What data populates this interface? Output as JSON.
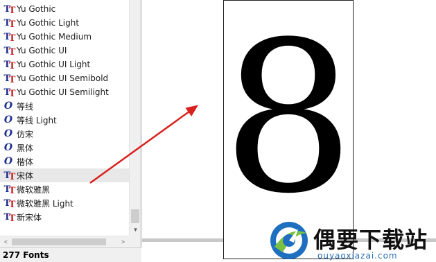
{
  "font_list": {
    "items": [
      {
        "name": "Yu Gothic",
        "icon": "truetype-icon"
      },
      {
        "name": "Yu Gothic Light",
        "icon": "truetype-icon"
      },
      {
        "name": "Yu Gothic Medium",
        "icon": "truetype-icon"
      },
      {
        "name": "Yu Gothic UI",
        "icon": "truetype-icon"
      },
      {
        "name": "Yu Gothic UI Light",
        "icon": "truetype-icon"
      },
      {
        "name": "Yu Gothic UI Semibold",
        "icon": "truetype-icon"
      },
      {
        "name": "Yu Gothic UI Semilight",
        "icon": "truetype-icon"
      },
      {
        "name": "等线",
        "icon": "opentype-icon"
      },
      {
        "name": "等线 Light",
        "icon": "opentype-icon"
      },
      {
        "name": "仿宋",
        "icon": "opentype-icon"
      },
      {
        "name": "黑体",
        "icon": "opentype-icon"
      },
      {
        "name": "楷体",
        "icon": "opentype-icon"
      },
      {
        "name": "宋体",
        "icon": "truetype-icon",
        "selected": true
      },
      {
        "name": "微软雅黑",
        "icon": "truetype-icon"
      },
      {
        "name": "微软雅黑 Light",
        "icon": "truetype-icon"
      },
      {
        "name": "新宋体",
        "icon": "truetype-icon"
      }
    ]
  },
  "status": {
    "font_count": "277 Fonts"
  },
  "preview": {
    "glyph": "8"
  },
  "watermark": {
    "title": "偶要下载站",
    "url": "ouyaoxiazai.com"
  },
  "colors": {
    "truetype_blue": "#1b2d8f",
    "truetype_red": "#c1272d",
    "arrow_red": "#d9201e",
    "selection": "#e8e8e8",
    "scrollbar_track": "#f0f0f0",
    "scrollbar_thumb": "#cdcdcd"
  }
}
